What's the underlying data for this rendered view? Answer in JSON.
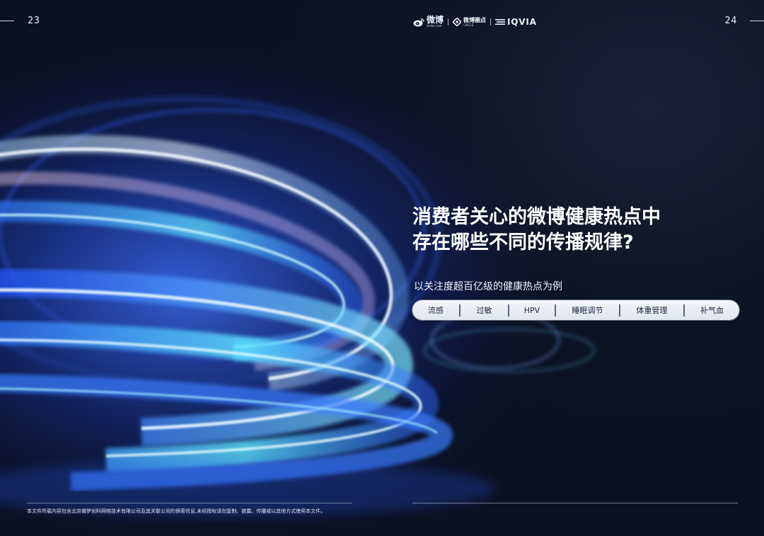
{
  "pages": {
    "left": "23",
    "right": "24"
  },
  "brand": {
    "weibo": "微博",
    "weibo_sub": "weibo.com",
    "circle": "微博圈点",
    "circle_sub": "CIRCLE",
    "iqvia": "IQVIA"
  },
  "headline": {
    "line1": "消费者关心的微博健康热点中",
    "line2": "存在哪些不同的传播规律?"
  },
  "subtitle": "以关注度超百亿级的健康热点为例",
  "tags": [
    "流感",
    "过敏",
    "HPV",
    "睡眠调节",
    "体重管理",
    "补气血"
  ],
  "disclaimer": "本文件所载内容包含北京微梦创科网络技术有限公司及其关联公司的保密信息,未经授权请勿复制、披露、传播或以其他方式使用本文件。",
  "colors": {
    "background": "#0b1226",
    "accent_blue": "#2f6bff",
    "accent_cyan": "#7fe8ff",
    "text": "#ffffff"
  }
}
